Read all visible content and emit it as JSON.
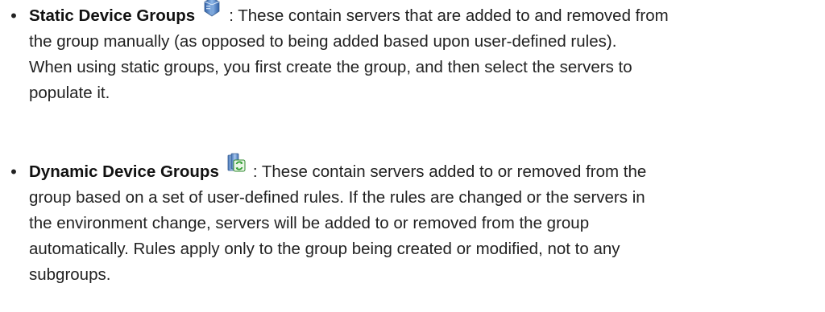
{
  "items": [
    {
      "term": "Static Device Groups",
      "icon": "static-device-group-icon",
      "lines": [
        ": These contain servers that are added to and removed from",
        "the group manually (as opposed to being added based upon user-defined rules).",
        "When using static groups, you first create the group, and then select the servers to",
        "populate it."
      ]
    },
    {
      "term": "Dynamic Device Groups",
      "icon": "dynamic-device-group-icon",
      "lines": [
        ": These contain servers added to or removed from the",
        "group based on a set of user-defined rules. If the rules are changed or the servers in",
        "the environment change, servers will be added to or removed from the group",
        "automatically. Rules apply only to the group being created or modified, not to any",
        "subgroups."
      ]
    }
  ],
  "colors": {
    "text": "#222222",
    "icon_blue": "#5b8fd0",
    "icon_green": "#3fae3f"
  }
}
